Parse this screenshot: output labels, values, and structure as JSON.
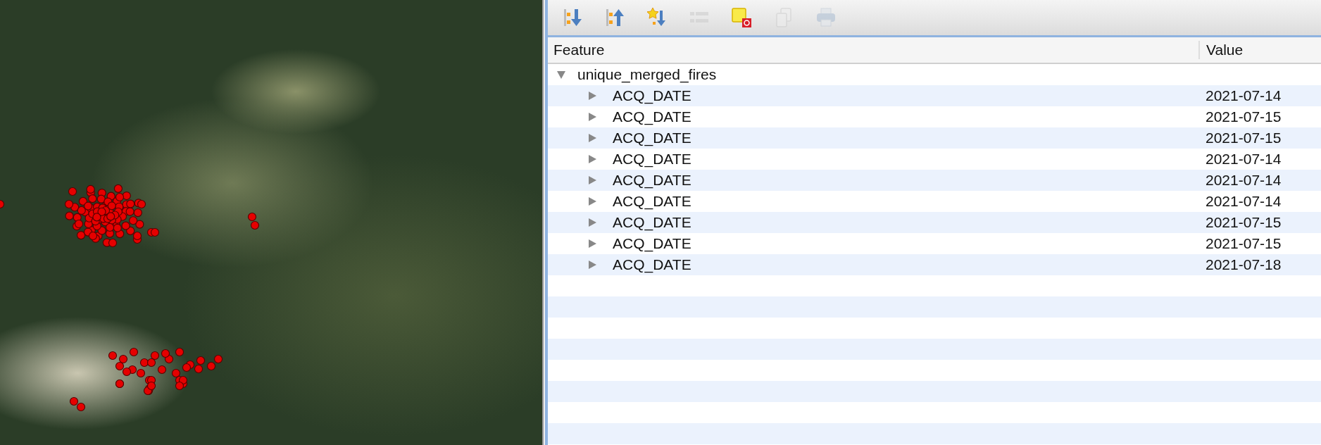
{
  "toolbar": [
    {
      "kind": "expand-all",
      "disabled": false
    },
    {
      "kind": "collapse-all",
      "disabled": false
    },
    {
      "kind": "expand-new",
      "disabled": false
    },
    {
      "kind": "list",
      "disabled": true
    },
    {
      "kind": "highlight",
      "disabled": false
    },
    {
      "kind": "copy",
      "disabled": true
    },
    {
      "kind": "print",
      "disabled": true
    }
  ],
  "table": {
    "columns": [
      "Feature",
      "Value"
    ],
    "tree": {
      "label": "unique_merged_fires",
      "expanded": true,
      "children": [
        {
          "label": "ACQ_DATE",
          "value": "2021-07-14",
          "expanded": false
        },
        {
          "label": "ACQ_DATE",
          "value": "2021-07-15",
          "expanded": false
        },
        {
          "label": "ACQ_DATE",
          "value": "2021-07-15",
          "expanded": false
        },
        {
          "label": "ACQ_DATE",
          "value": "2021-07-14",
          "expanded": false
        },
        {
          "label": "ACQ_DATE",
          "value": "2021-07-14",
          "expanded": false
        },
        {
          "label": "ACQ_DATE",
          "value": "2021-07-14",
          "expanded": false
        },
        {
          "label": "ACQ_DATE",
          "value": "2021-07-15",
          "expanded": false
        },
        {
          "label": "ACQ_DATE",
          "value": "2021-07-15",
          "expanded": false
        },
        {
          "label": "ACQ_DATE",
          "value": "2021-07-18",
          "expanded": false
        }
      ]
    }
  }
}
